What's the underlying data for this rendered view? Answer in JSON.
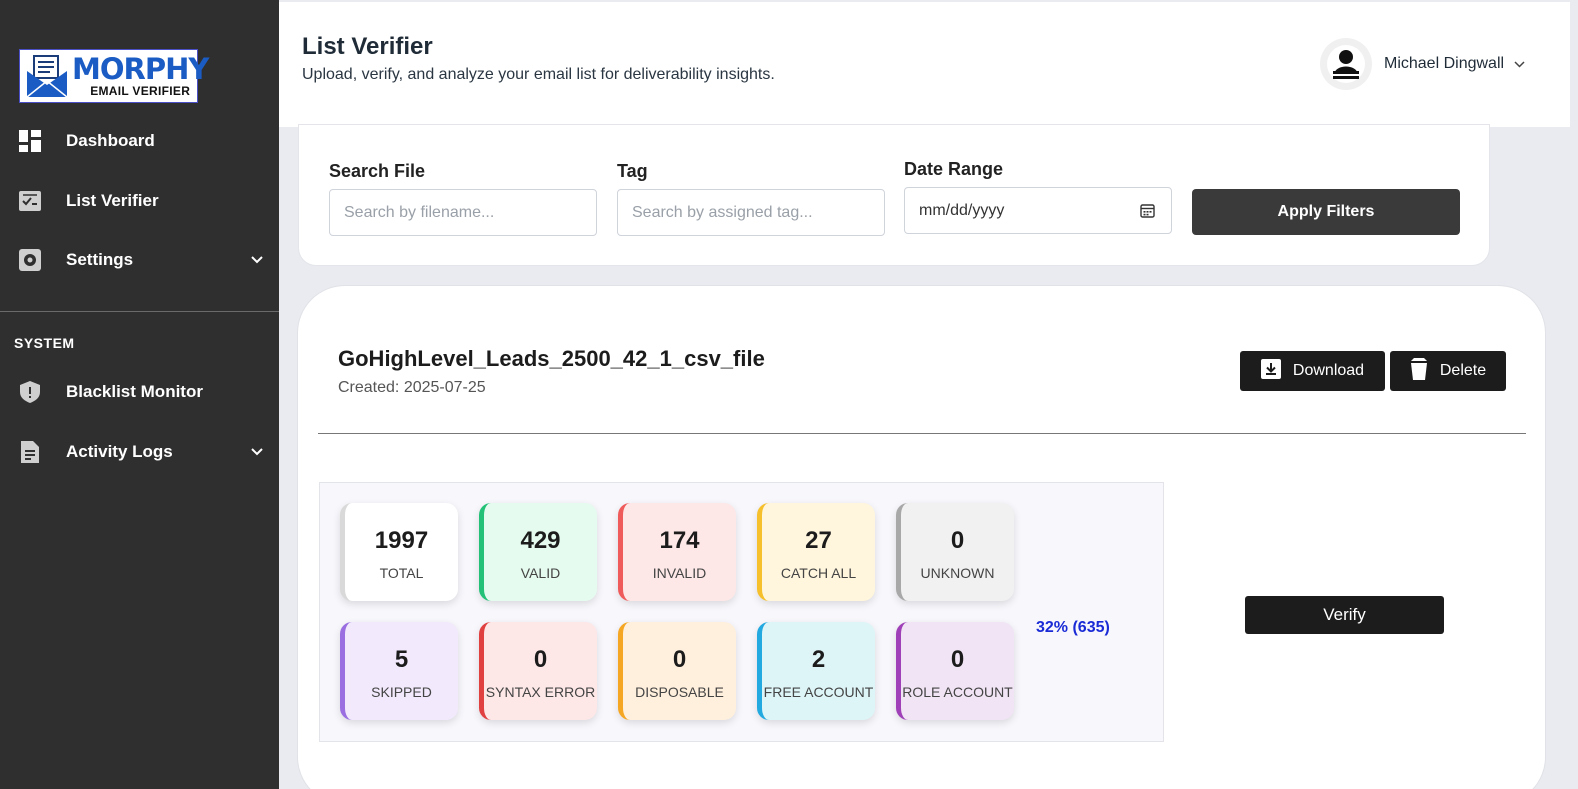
{
  "sidebar": {
    "logo": {
      "main": "MORPHY",
      "sub": "EMAIL VERIFIER"
    },
    "items": [
      {
        "label": "Dashboard",
        "icon": "dashboard-icon"
      },
      {
        "label": "List Verifier",
        "icon": "list-check-icon"
      },
      {
        "label": "Settings",
        "icon": "gear-icon",
        "expandable": true
      }
    ],
    "section_label": "SYSTEM",
    "system_items": [
      {
        "label": "Blacklist Monitor",
        "icon": "shield-icon"
      },
      {
        "label": "Activity Logs",
        "icon": "document-icon",
        "expandable": true
      }
    ]
  },
  "header": {
    "title": "List Verifier",
    "subtitle": "Upload, verify, and analyze your email list for deliverability insights.",
    "user_name": "Michael Dingwall"
  },
  "filters": {
    "search_label": "Search File",
    "search_placeholder": "Search by filename...",
    "tag_label": "Tag",
    "tag_placeholder": "Search by assigned tag...",
    "date_label": "Date Range",
    "date_value": "mm/dd/yyyy",
    "apply_label": "Apply Filters"
  },
  "file": {
    "name": "GoHighLevel_Leads_2500_42_1_csv_file",
    "created": "Created: 2025-07-25",
    "download_label": "Download",
    "delete_label": "Delete",
    "verify_label": "Verify",
    "progress_text": "32% (635)",
    "stats": [
      {
        "value": "1997",
        "label": "TOTAL",
        "bg": "#ffffff",
        "accent": "#d9d9d9"
      },
      {
        "value": "429",
        "label": "VALID",
        "bg": "#e6fbef",
        "accent": "#22c177"
      },
      {
        "value": "174",
        "label": "INVALID",
        "bg": "#fde7e7",
        "accent": "#ef5a5a"
      },
      {
        "value": "27",
        "label": "CATCH ALL",
        "bg": "#fff6dd",
        "accent": "#f5c02b"
      },
      {
        "value": "0",
        "label": "UNKNOWN",
        "bg": "#f1f1f1",
        "accent": "#a8a8a8"
      },
      {
        "value": "5",
        "label": "SKIPPED",
        "bg": "#f2eafc",
        "accent": "#9a6ee0"
      },
      {
        "value": "0",
        "label": "SYNTAX ERROR",
        "bg": "#fde7e7",
        "accent": "#e04040"
      },
      {
        "value": "0",
        "label": "DISPOSABLE",
        "bg": "#fff0dd",
        "accent": "#f5a623"
      },
      {
        "value": "2",
        "label": "FREE ACCOUNT",
        "bg": "#def5f8",
        "accent": "#22a9e0"
      },
      {
        "value": "0",
        "label": "ROLE ACCOUNT",
        "bg": "#f1e4f5",
        "accent": "#a040b8"
      }
    ]
  }
}
